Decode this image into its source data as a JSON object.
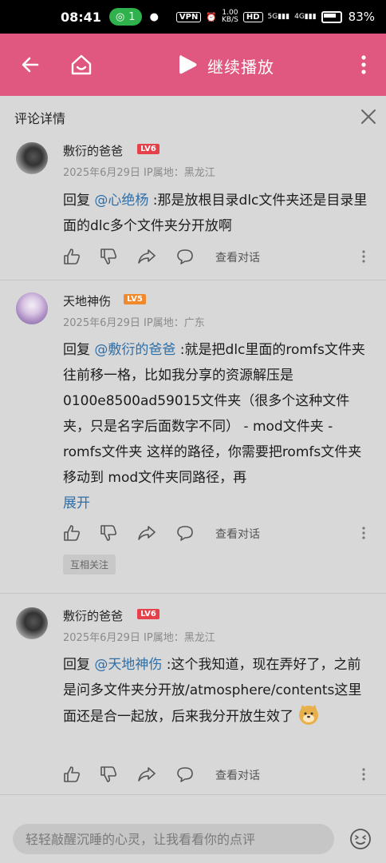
{
  "status_bar": {
    "time": "08:41",
    "hotspot_count": "1",
    "vpn": "VPN",
    "speed": "1.00\nKB/S",
    "hd": "HD",
    "net1": "5G",
    "net2": "4G",
    "battery": "83%"
  },
  "app_bar": {
    "title": "继续播放",
    "accent_color": "#e0587f"
  },
  "panel": {
    "title": "评论详情"
  },
  "comments": [
    {
      "username": "敷衍的爸爸",
      "level": "LV6",
      "date": "2025年6月29日",
      "location": "IP属地：黑龙江",
      "reply_prefix": "回复 ",
      "mention": "@心绝杨",
      "text": " :那是放根目录dlc文件夹还是目录里面的dlc多个文件夹分开放啊",
      "view_conversation": "查看对话"
    },
    {
      "username": "天地神伤",
      "level": "LV5",
      "date": "2025年6月29日",
      "location": "IP属地：广东",
      "reply_prefix": "回复 ",
      "mention": "@敷衍的爸爸",
      "text": " :就是把dlc里面的romfs文件夹往前移一格，比如我分享的资源解压是0100e8500ad59015文件夹（很多个这种文件夹，只是名字后面数字不同） - mod文件夹 - romfs文件夹 这样的路径，你需要把romfs文件夹移动到 mod文件夹同路径，再",
      "expand": "展开",
      "view_conversation": "查看对话",
      "tag": "互相关注"
    },
    {
      "username": "敷衍的爸爸",
      "level": "LV6",
      "date": "2025年6月29日",
      "location": "IP属地：黑龙江",
      "reply_prefix": "回复 ",
      "mention": "@天地神伤",
      "text": " :这个我知道，现在弄好了，之前是问多文件夹分开放/atmosphere/contents这里面还是合一起放，后来我分开放生效了",
      "view_conversation": "查看对话"
    }
  ],
  "input": {
    "placeholder": "轻轻敲醒沉睡的心灵，让我看看你的点评"
  }
}
